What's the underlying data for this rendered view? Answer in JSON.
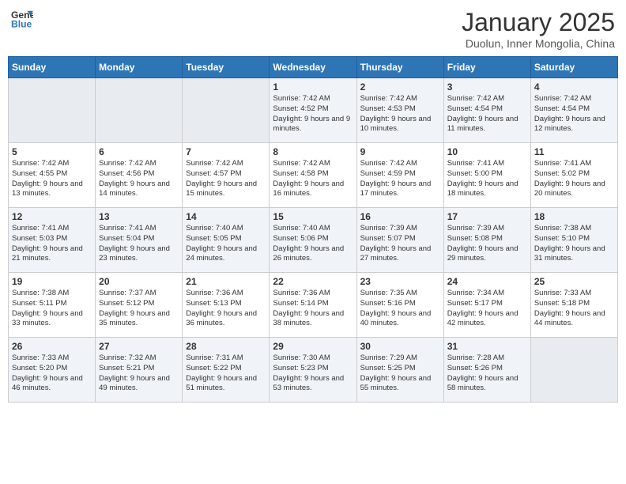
{
  "logo": {
    "general": "General",
    "blue": "Blue"
  },
  "header": {
    "month": "January 2025",
    "location": "Duolun, Inner Mongolia, China"
  },
  "weekdays": [
    "Sunday",
    "Monday",
    "Tuesday",
    "Wednesday",
    "Thursday",
    "Friday",
    "Saturday"
  ],
  "weeks": [
    [
      {
        "day": "",
        "empty": true
      },
      {
        "day": "",
        "empty": true
      },
      {
        "day": "",
        "empty": true
      },
      {
        "day": "1",
        "sunrise": "7:42 AM",
        "sunset": "4:52 PM",
        "daylight": "9 hours and 9 minutes."
      },
      {
        "day": "2",
        "sunrise": "7:42 AM",
        "sunset": "4:53 PM",
        "daylight": "9 hours and 10 minutes."
      },
      {
        "day": "3",
        "sunrise": "7:42 AM",
        "sunset": "4:54 PM",
        "daylight": "9 hours and 11 minutes."
      },
      {
        "day": "4",
        "sunrise": "7:42 AM",
        "sunset": "4:54 PM",
        "daylight": "9 hours and 12 minutes."
      }
    ],
    [
      {
        "day": "5",
        "sunrise": "7:42 AM",
        "sunset": "4:55 PM",
        "daylight": "9 hours and 13 minutes."
      },
      {
        "day": "6",
        "sunrise": "7:42 AM",
        "sunset": "4:56 PM",
        "daylight": "9 hours and 14 minutes."
      },
      {
        "day": "7",
        "sunrise": "7:42 AM",
        "sunset": "4:57 PM",
        "daylight": "9 hours and 15 minutes."
      },
      {
        "day": "8",
        "sunrise": "7:42 AM",
        "sunset": "4:58 PM",
        "daylight": "9 hours and 16 minutes."
      },
      {
        "day": "9",
        "sunrise": "7:42 AM",
        "sunset": "4:59 PM",
        "daylight": "9 hours and 17 minutes."
      },
      {
        "day": "10",
        "sunrise": "7:41 AM",
        "sunset": "5:00 PM",
        "daylight": "9 hours and 18 minutes."
      },
      {
        "day": "11",
        "sunrise": "7:41 AM",
        "sunset": "5:02 PM",
        "daylight": "9 hours and 20 minutes."
      }
    ],
    [
      {
        "day": "12",
        "sunrise": "7:41 AM",
        "sunset": "5:03 PM",
        "daylight": "9 hours and 21 minutes."
      },
      {
        "day": "13",
        "sunrise": "7:41 AM",
        "sunset": "5:04 PM",
        "daylight": "9 hours and 23 minutes."
      },
      {
        "day": "14",
        "sunrise": "7:40 AM",
        "sunset": "5:05 PM",
        "daylight": "9 hours and 24 minutes."
      },
      {
        "day": "15",
        "sunrise": "7:40 AM",
        "sunset": "5:06 PM",
        "daylight": "9 hours and 26 minutes."
      },
      {
        "day": "16",
        "sunrise": "7:39 AM",
        "sunset": "5:07 PM",
        "daylight": "9 hours and 27 minutes."
      },
      {
        "day": "17",
        "sunrise": "7:39 AM",
        "sunset": "5:08 PM",
        "daylight": "9 hours and 29 minutes."
      },
      {
        "day": "18",
        "sunrise": "7:38 AM",
        "sunset": "5:10 PM",
        "daylight": "9 hours and 31 minutes."
      }
    ],
    [
      {
        "day": "19",
        "sunrise": "7:38 AM",
        "sunset": "5:11 PM",
        "daylight": "9 hours and 33 minutes."
      },
      {
        "day": "20",
        "sunrise": "7:37 AM",
        "sunset": "5:12 PM",
        "daylight": "9 hours and 35 minutes."
      },
      {
        "day": "21",
        "sunrise": "7:36 AM",
        "sunset": "5:13 PM",
        "daylight": "9 hours and 36 minutes."
      },
      {
        "day": "22",
        "sunrise": "7:36 AM",
        "sunset": "5:14 PM",
        "daylight": "9 hours and 38 minutes."
      },
      {
        "day": "23",
        "sunrise": "7:35 AM",
        "sunset": "5:16 PM",
        "daylight": "9 hours and 40 minutes."
      },
      {
        "day": "24",
        "sunrise": "7:34 AM",
        "sunset": "5:17 PM",
        "daylight": "9 hours and 42 minutes."
      },
      {
        "day": "25",
        "sunrise": "7:33 AM",
        "sunset": "5:18 PM",
        "daylight": "9 hours and 44 minutes."
      }
    ],
    [
      {
        "day": "26",
        "sunrise": "7:33 AM",
        "sunset": "5:20 PM",
        "daylight": "9 hours and 46 minutes."
      },
      {
        "day": "27",
        "sunrise": "7:32 AM",
        "sunset": "5:21 PM",
        "daylight": "9 hours and 49 minutes."
      },
      {
        "day": "28",
        "sunrise": "7:31 AM",
        "sunset": "5:22 PM",
        "daylight": "9 hours and 51 minutes."
      },
      {
        "day": "29",
        "sunrise": "7:30 AM",
        "sunset": "5:23 PM",
        "daylight": "9 hours and 53 minutes."
      },
      {
        "day": "30",
        "sunrise": "7:29 AM",
        "sunset": "5:25 PM",
        "daylight": "9 hours and 55 minutes."
      },
      {
        "day": "31",
        "sunrise": "7:28 AM",
        "sunset": "5:26 PM",
        "daylight": "9 hours and 58 minutes."
      },
      {
        "day": "",
        "empty": true
      }
    ]
  ]
}
